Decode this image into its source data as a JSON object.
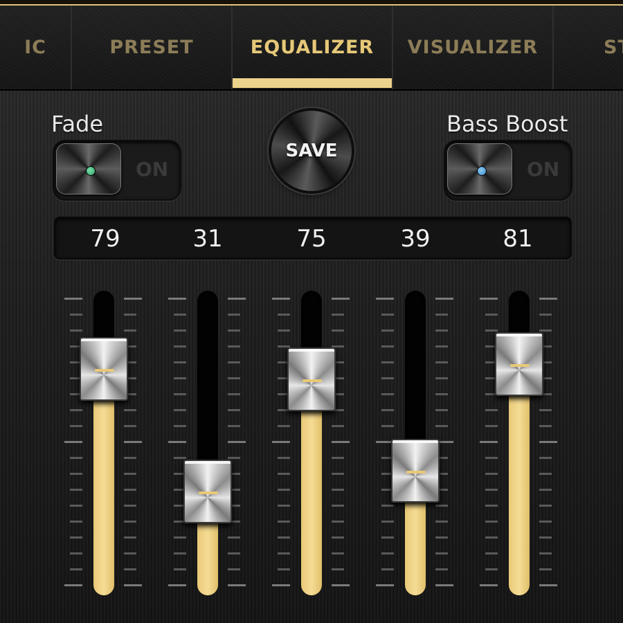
{
  "tabs": [
    {
      "label": "IC",
      "active": false
    },
    {
      "label": "PRESET",
      "active": false
    },
    {
      "label": "EQUALIZER",
      "active": true
    },
    {
      "label": "VISUALIZER",
      "active": false
    },
    {
      "label": "ST",
      "active": false
    }
  ],
  "fade": {
    "label": "Fade",
    "state_text": "ON",
    "on": false,
    "led_color": "#2e9e66"
  },
  "bass_boost": {
    "label": "Bass Boost",
    "state_text": "ON",
    "on": false,
    "led_color": "#3a8fd0"
  },
  "save_label": "SAVE",
  "bands": [
    {
      "value": "79",
      "level": 79
    },
    {
      "value": "31",
      "level": 31
    },
    {
      "value": "75",
      "level": 75
    },
    {
      "value": "39",
      "level": 39
    },
    {
      "value": "81",
      "level": 81
    }
  ],
  "colors": {
    "accent": "#e6c878",
    "background": "#1d1d1d"
  }
}
